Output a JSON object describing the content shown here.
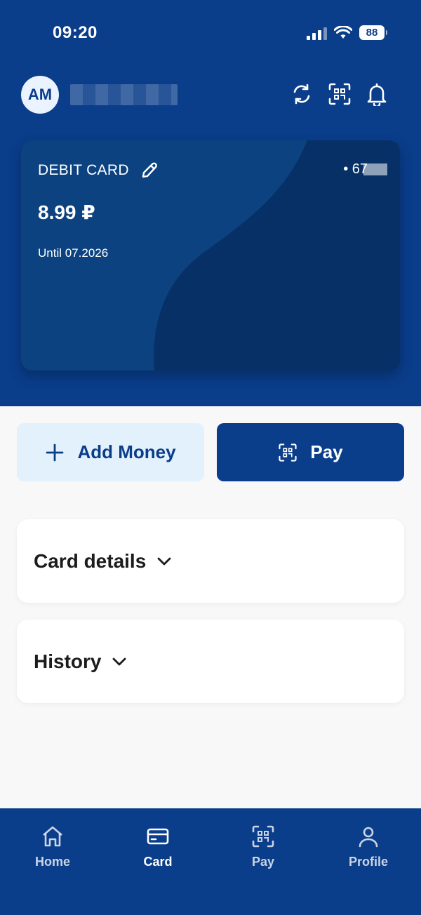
{
  "status_bar": {
    "time": "09:20",
    "battery": "88"
  },
  "header": {
    "avatar_initials": "AM",
    "icons": [
      "refresh-icon",
      "qr-scan-icon",
      "bell-icon"
    ]
  },
  "card": {
    "title": "DEBIT CARD",
    "number_prefix": "• 67",
    "balance": "8.99 ₽",
    "expiry": "Until 07.2026"
  },
  "actions": {
    "add_money_label": "Add Money",
    "pay_label": "Pay"
  },
  "sections": {
    "card_details": "Card details",
    "history": "History"
  },
  "bottom_nav": {
    "items": [
      {
        "label": "Home",
        "icon": "home-icon"
      },
      {
        "label": "Card",
        "icon": "card-icon"
      },
      {
        "label": "Pay",
        "icon": "qr-scan-icon"
      },
      {
        "label": "Profile",
        "icon": "profile-icon"
      }
    ],
    "active": "Card"
  },
  "colors": {
    "primary": "#0a3d8a",
    "card": "#063066",
    "add_money_bg": "#e3f1fd",
    "page_bg": "#f8f8f9"
  }
}
